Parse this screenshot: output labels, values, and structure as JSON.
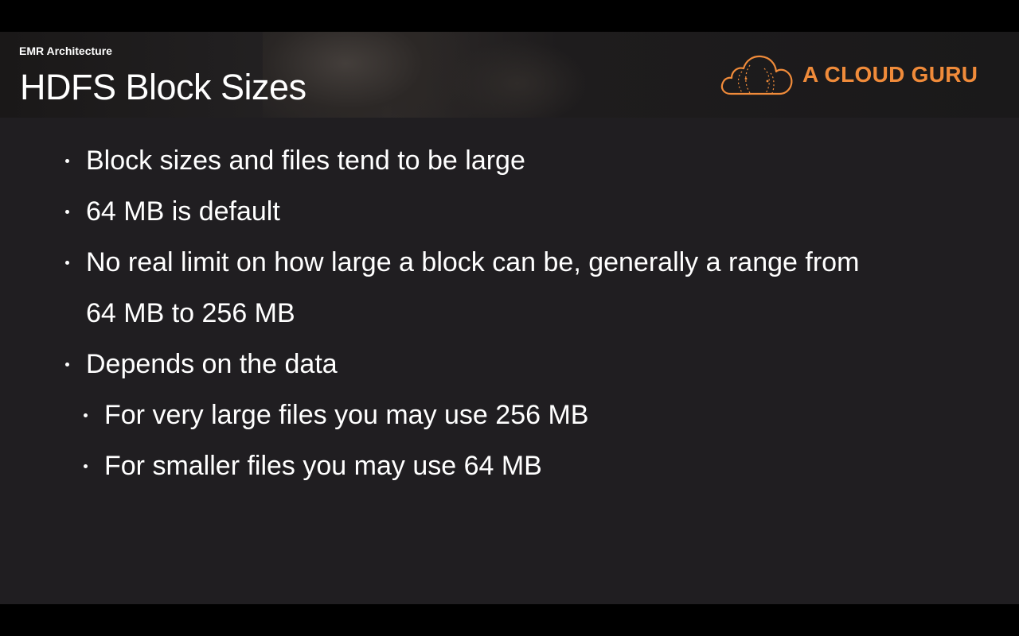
{
  "header": {
    "section_label": "EMR Architecture",
    "title": "HDFS Block Sizes",
    "logo_text": "A CLOUD GURU",
    "logo_icon": "cloud-icon",
    "brand_color": "#f08b3a"
  },
  "bullets": [
    {
      "text": "Block sizes and files tend to be large",
      "level": 1
    },
    {
      "text": "64 MB is default",
      "level": 1
    },
    {
      "text": "No real limit on how large a block can be, generally a range from",
      "level": 1
    },
    {
      "text": "64 MB to 256 MB",
      "level": 1,
      "continuation": true
    },
    {
      "text": "Depends on the data",
      "level": 1
    },
    {
      "text": "For very large files you may use 256 MB",
      "level": 2
    },
    {
      "text": "For smaller files you may use 64 MB",
      "level": 2
    }
  ]
}
